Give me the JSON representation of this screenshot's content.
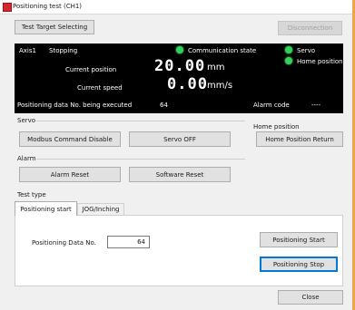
{
  "window": {
    "title": "Positioning test (CH1)"
  },
  "toolbar": {
    "test_target_label": "Test Target Selecting",
    "disconnection_label": "Disconnection"
  },
  "status": {
    "axis": "Axis1",
    "state": "Stopping",
    "current_position_label": "Current position",
    "current_position_value": "20.00",
    "current_position_unit": "mm",
    "current_speed_label": "Current speed",
    "current_speed_value": "0.00",
    "current_speed_unit": "mm/s",
    "data_no_label": "Positioning data No. being executed",
    "data_no_value": "64",
    "communication_label": "Communication state",
    "servo_label": "Servo",
    "home_position_label": "Home position",
    "alarm_code_label": "Alarm code",
    "alarm_code_value": "----",
    "led_color": "#2fd35a"
  },
  "servo": {
    "group_label": "Servo",
    "modbus_disable_label": "Modbus Command Disable",
    "servo_off_label": "Servo OFF"
  },
  "home": {
    "group_label": "Home position",
    "return_label": "Home Position Return"
  },
  "alarm": {
    "group_label": "Alarm",
    "reset_label": "Alarm Reset",
    "software_reset_label": "Software Reset"
  },
  "test_type": {
    "group_label": "Test type",
    "tabs": [
      {
        "label": "Positioning start"
      },
      {
        "label": "JOG/Inching"
      }
    ],
    "data_no_label": "Positioning Data No.",
    "data_no_value": "64",
    "start_label": "Positioning Start",
    "stop_label": "Positioning Stop"
  },
  "footer": {
    "close_label": "Close"
  }
}
